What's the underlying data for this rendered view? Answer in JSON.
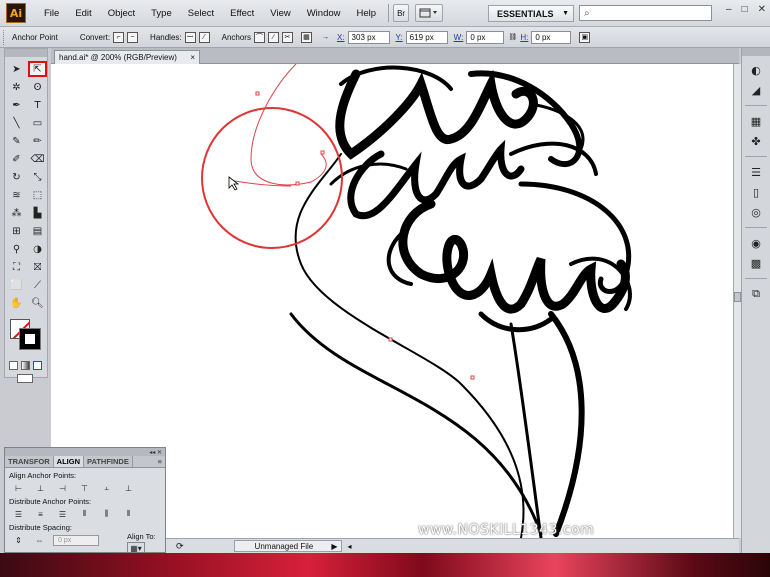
{
  "app": {
    "logo_text": "Ai",
    "workspace": "ESSENTIALS",
    "search_placeholder": ""
  },
  "menu": [
    "File",
    "Edit",
    "Object",
    "Type",
    "Select",
    "Effect",
    "View",
    "Window",
    "Help"
  ],
  "menubar_buttons": {
    "bridge": "Br"
  },
  "control_bar": {
    "tool_name": "Anchor Point",
    "convert_label": "Convert:",
    "handles_label": "Handles:",
    "anchors_label": "Anchors",
    "x_label": "X:",
    "x_value": "303 px",
    "y_label": "Y:",
    "y_value": "619 px",
    "w_label": "W:",
    "w_value": "0 px",
    "h_label": "H:",
    "h_value": "0 px"
  },
  "document": {
    "tab_title": "hand.ai* @ 200% (RGB/Preview)",
    "close": "×"
  },
  "artwork": {
    "words": [
      "Rise",
      "and",
      "Shine"
    ]
  },
  "status_bar": {
    "file_state": "Unmanaged File"
  },
  "align_panel": {
    "tabs": [
      "TRANSFOR",
      "ALIGN",
      "PATHFINDE"
    ],
    "align_anchor_label": "Align Anchor Points:",
    "distribute_anchor_label": "Distribute Anchor Points:",
    "distribute_spacing_label": "Distribute Spacing:",
    "align_to_label": "Align To:",
    "spacing_value": "0 px"
  },
  "watermark": "www.NOSKILL1343.com",
  "colors": {
    "selection_red": "#d11111",
    "canvas": "#ffffff",
    "path_red": "#e0404a"
  }
}
